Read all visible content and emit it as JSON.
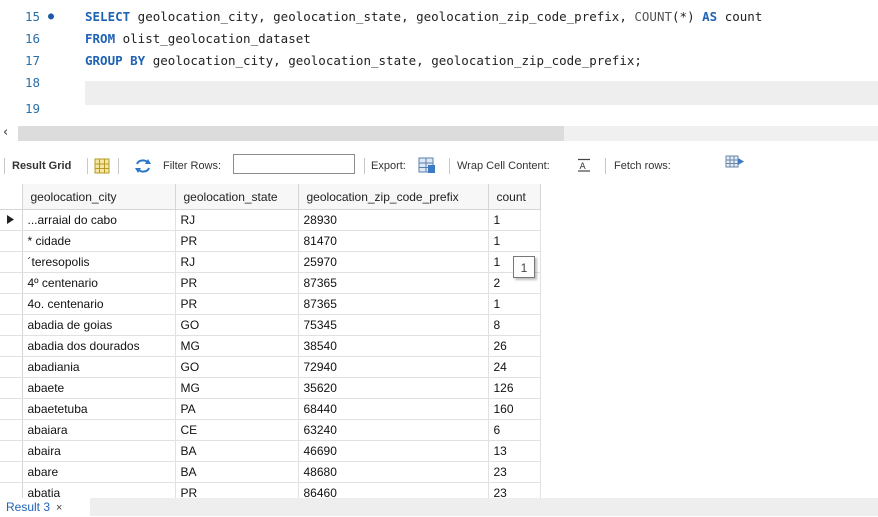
{
  "editor": {
    "lines": [
      {
        "num": "15",
        "marker": "●",
        "tokens": [
          {
            "t": "SELECT",
            "k": "kw"
          },
          {
            "t": " geolocation_city, geolocation_state, geolocation_zip_code_prefix, ",
            "k": "plain"
          },
          {
            "t": "COUNT",
            "k": "fn"
          },
          {
            "t": "(*) ",
            "k": "plain"
          },
          {
            "t": "AS",
            "k": "kw"
          },
          {
            "t": " count",
            "k": "plain"
          }
        ]
      },
      {
        "num": "16",
        "marker": "",
        "tokens": [
          {
            "t": "FROM",
            "k": "kw"
          },
          {
            "t": " olist_geolocation_dataset",
            "k": "plain"
          }
        ]
      },
      {
        "num": "17",
        "marker": "",
        "tokens": [
          {
            "t": "GROUP BY",
            "k": "kw"
          },
          {
            "t": " geolocation_city, geolocation_state, geolocation_zip_code_prefix;",
            "k": "plain"
          }
        ]
      },
      {
        "num": "18",
        "marker": "",
        "tokens": []
      },
      {
        "num": "19",
        "marker": "",
        "tokens": []
      }
    ]
  },
  "toolbar": {
    "result_grid_label": "Result Grid",
    "filter_rows_label": "Filter Rows:",
    "filter_rows_value": "",
    "export_label": "Export:",
    "wrap_cell_label": "Wrap Cell Content:",
    "fetch_rows_label": "Fetch rows:"
  },
  "grid": {
    "columns": [
      "geolocation_city",
      "geolocation_state",
      "geolocation_zip_code_prefix",
      "count"
    ],
    "rows": [
      [
        "...arraial do cabo",
        "RJ",
        "28930",
        "1"
      ],
      [
        "* cidade",
        "PR",
        "81470",
        "1"
      ],
      [
        "´teresopolis",
        "RJ",
        "25970",
        "1"
      ],
      [
        "4º centenario",
        "PR",
        "87365",
        "2"
      ],
      [
        "4o. centenario",
        "PR",
        "87365",
        "1"
      ],
      [
        "abadia de goias",
        "GO",
        "75345",
        "8"
      ],
      [
        "abadia dos dourados",
        "MG",
        "38540",
        "26"
      ],
      [
        "abadiania",
        "GO",
        "72940",
        "24"
      ],
      [
        "abaete",
        "MG",
        "35620",
        "126"
      ],
      [
        "abaetetuba",
        "PA",
        "68440",
        "160"
      ],
      [
        "abaiara",
        "CE",
        "63240",
        "6"
      ],
      [
        "abaira",
        "BA",
        "46690",
        "13"
      ],
      [
        "abare",
        "BA",
        "48680",
        "23"
      ],
      [
        "abatia",
        "PR",
        "86460",
        "23"
      ]
    ],
    "tooltip_value": "1"
  },
  "tabs": {
    "result_tab_label": "Result 3",
    "close_glyph": "×"
  },
  "colors": {
    "keyword": "#1f63b5",
    "line_number": "#2a6fa8"
  }
}
